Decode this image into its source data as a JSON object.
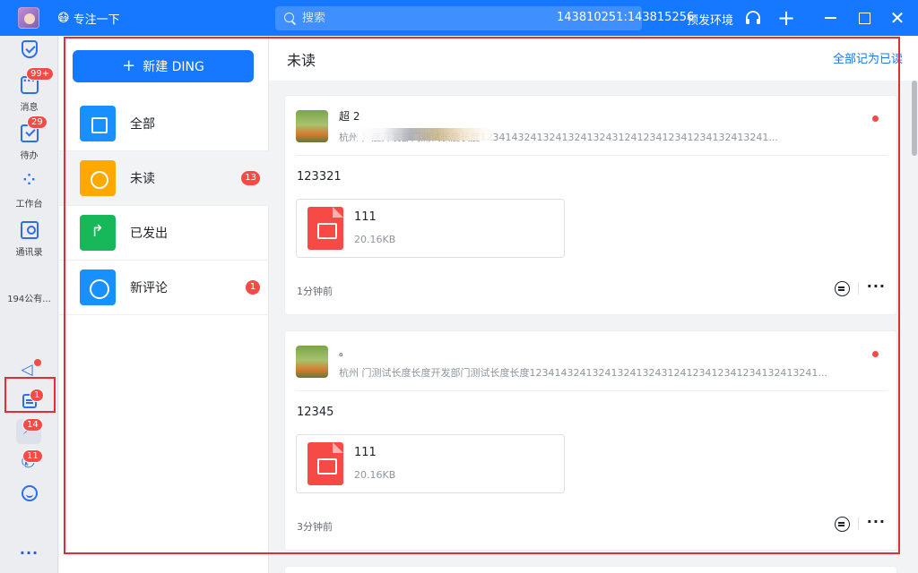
{
  "titlebar": {
    "status_emoji": "😷",
    "status_text": "专注一下",
    "search_placeholder": "搜索",
    "account": "143810251:143815256",
    "env": "预发环境",
    "plus_glyph": "+",
    "close_glyph": "✕"
  },
  "rail": {
    "messages": {
      "label": "消息",
      "badge": "99+"
    },
    "todo": {
      "label": "待办",
      "badge": "29"
    },
    "workbench": {
      "label": "工作台"
    },
    "contacts": {
      "label": "通讯录"
    },
    "org": {
      "label": "194公有..."
    },
    "notes_badge": "1",
    "ding_badge": "14",
    "call_badge": "11",
    "more": "···"
  },
  "sidebar": {
    "new_ding": {
      "plus": "+",
      "label": "新建 DING"
    },
    "categories": [
      {
        "name": "全部",
        "badge": ""
      },
      {
        "name": "未读",
        "badge": "13"
      },
      {
        "name": "已发出",
        "badge": ""
      },
      {
        "name": "新评论",
        "badge": "1"
      }
    ]
  },
  "main": {
    "title": "未读",
    "mark_all_read": "全部记为已读",
    "cards": [
      {
        "sender": "超  2",
        "subtitle": "杭州                                  ）度开发部门测试长度长度1234143241324132413243124123412341234132413241...",
        "body": "123321",
        "file": {
          "name": "111",
          "size": "20.16KB"
        },
        "time": "1分钟前",
        "more": "···"
      },
      {
        "sender": "  。",
        "subtitle": "杭州          门测试长度长度开发部门测试长度长度1234143241324132413243124123412341234132413241...",
        "body": "12345",
        "file": {
          "name": "111",
          "size": "20.16KB"
        },
        "time": "3分钟前",
        "more": "···"
      }
    ]
  },
  "colors": {
    "brand": "#1677ff",
    "badge": "#f54a45",
    "highlight": "#e02d36",
    "unread_icon": "#ffa800",
    "sent_icon": "#16b85a"
  },
  "icons": {
    "titlebar": [
      "avatar",
      "search-icon",
      "headset-icon",
      "plus-icon",
      "minimize-icon",
      "maximize-icon",
      "close-icon"
    ],
    "rail": [
      "shield-icon",
      "chat-icon",
      "todo-check-icon",
      "grid-apps-icon",
      "contacts-icon",
      "speaker-icon",
      "notes-icon",
      "ding-lightning-icon",
      "phone-icon",
      "cloud-smile-icon",
      "more-dots-icon"
    ]
  }
}
